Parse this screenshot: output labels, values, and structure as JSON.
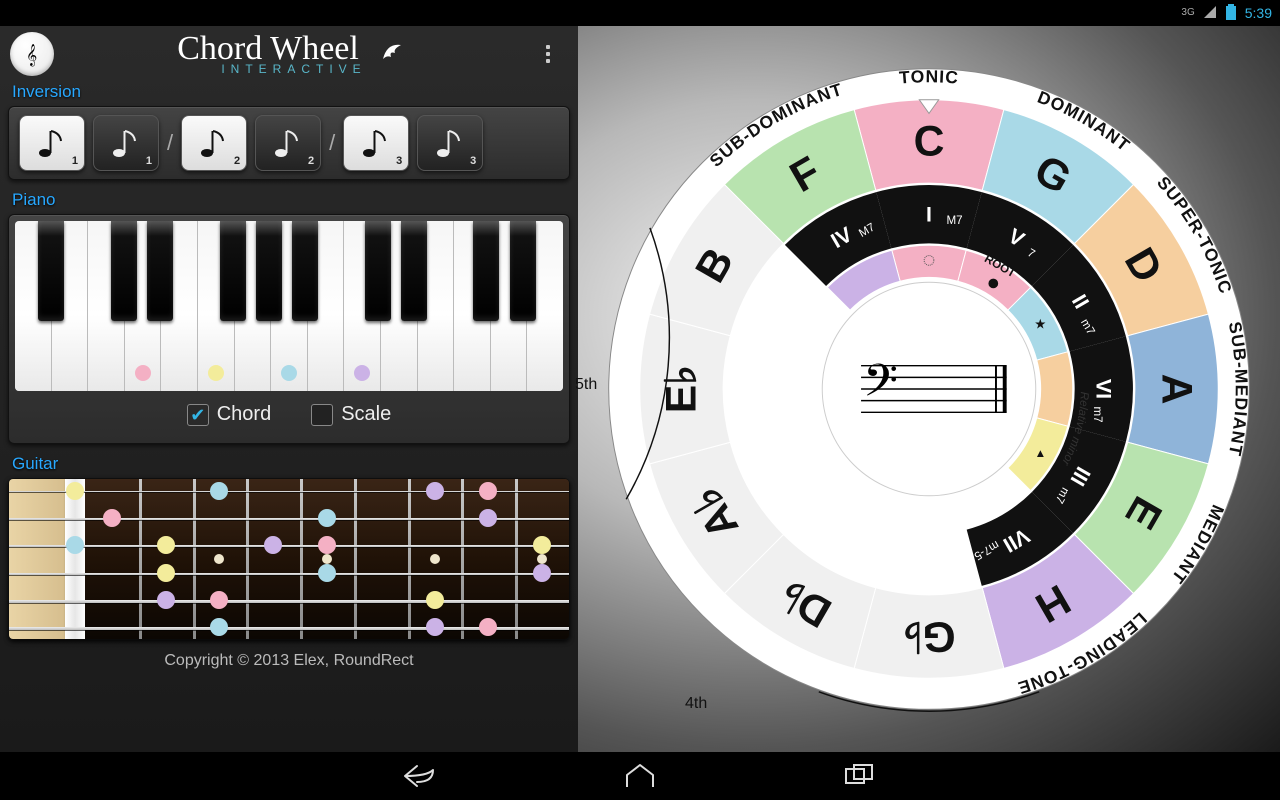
{
  "status": {
    "net_label": "3G",
    "time": "5:39"
  },
  "header": {
    "title": "Chord Wheel",
    "subtitle": "INTERACTIVE"
  },
  "sections": {
    "inversion": "Inversion",
    "piano": "Piano",
    "guitar": "Guitar"
  },
  "inversion": {
    "items": [
      {
        "sub": "1",
        "dark": false
      },
      {
        "sub": "1",
        "dark": true
      },
      {
        "sub": "2",
        "dark": false
      },
      {
        "sub": "2",
        "dark": true
      },
      {
        "sub": "3",
        "dark": false
      },
      {
        "sub": "3",
        "dark": true
      }
    ]
  },
  "piano": {
    "options": {
      "chord_label": "Chord",
      "scale_label": "Scale",
      "chord_checked": true,
      "scale_checked": false
    },
    "dots": [
      {
        "white_index": 3,
        "color": "c-pink"
      },
      {
        "white_index": 5,
        "color": "c-yellow"
      },
      {
        "white_index": 7,
        "color": "c-blue"
      },
      {
        "white_index": 9,
        "color": "c-purple"
      }
    ]
  },
  "guitar": {
    "strings": 6,
    "frets": 9,
    "markers_single": [
      3,
      5,
      7,
      9
    ],
    "dots": [
      {
        "string": 1,
        "fret": 0,
        "color": "c-yellow"
      },
      {
        "string": 1,
        "fret": 3,
        "color": "c-blue"
      },
      {
        "string": 1,
        "fret": 7,
        "color": "c-purple"
      },
      {
        "string": 1,
        "fret": 8,
        "color": "c-pink"
      },
      {
        "string": 2,
        "fret": 1,
        "color": "c-pink"
      },
      {
        "string": 2,
        "fret": 5,
        "color": "c-blue"
      },
      {
        "string": 2,
        "fret": 8,
        "color": "c-purple"
      },
      {
        "string": 3,
        "fret": 0,
        "color": "c-blue"
      },
      {
        "string": 3,
        "fret": 2,
        "color": "c-yellow"
      },
      {
        "string": 3,
        "fret": 4,
        "color": "c-purple"
      },
      {
        "string": 3,
        "fret": 5,
        "color": "c-pink"
      },
      {
        "string": 3,
        "fret": 9,
        "color": "c-yellow"
      },
      {
        "string": 4,
        "fret": 2,
        "color": "c-yellow"
      },
      {
        "string": 4,
        "fret": 5,
        "color": "c-blue"
      },
      {
        "string": 4,
        "fret": 9,
        "color": "c-purple"
      },
      {
        "string": 5,
        "fret": 2,
        "color": "c-purple"
      },
      {
        "string": 5,
        "fret": 3,
        "color": "c-pink"
      },
      {
        "string": 5,
        "fret": 7,
        "color": "c-yellow"
      },
      {
        "string": 6,
        "fret": 3,
        "color": "c-blue"
      },
      {
        "string": 6,
        "fret": 7,
        "color": "c-purple"
      },
      {
        "string": 6,
        "fret": 8,
        "color": "c-pink"
      }
    ]
  },
  "footer": {
    "copyright": "Copyright © 2013 Elex, RoundRect"
  },
  "wheel": {
    "roles": [
      "TONIC",
      "DOMINANT",
      "SUPER-TONIC",
      "SUB-MEDIANT",
      "MEDIANT",
      "LEADING-TONE",
      "",
      "",
      "",
      "",
      "",
      "SUB-DOMINANT"
    ],
    "outer_notes": [
      "C",
      "G",
      "D",
      "A",
      "E",
      "H",
      "G♭",
      "D♭",
      "A♭",
      "E♭",
      "B",
      "F"
    ],
    "outer_colors": [
      "#f4b0c4",
      "#a9d9e7",
      "#f6cf9f",
      "#8fb4d9",
      "#b8e3af",
      "#cbb2e6",
      "#f0f0f0",
      "#f0f0f0",
      "#f0f0f0",
      "#f0f0f0",
      "#f0f0f0",
      "#b8e3af"
    ],
    "inner_roman": [
      {
        "n": "I",
        "s": "M7"
      },
      {
        "n": "V",
        "s": "7"
      },
      {
        "n": "II",
        "s": "m7"
      },
      {
        "n": "VI",
        "s": "m7"
      },
      {
        "n": "III",
        "s": "m7"
      },
      {
        "n": "VII",
        "s": "m7-5"
      },
      {
        "n": "",
        "s": ""
      },
      {
        "n": "",
        "s": ""
      },
      {
        "n": "",
        "s": ""
      },
      {
        "n": "",
        "s": ""
      },
      {
        "n": "",
        "s": ""
      },
      {
        "n": "IV",
        "s": "M7"
      }
    ],
    "inner_colors": [
      "#f4b0c4",
      "#f4b0c4",
      "#a9d9e7",
      "#f6cf9f",
      "#f3ec9b",
      "",
      "",
      "",
      "",
      "",
      "",
      "#cbb2e6"
    ],
    "root_label": "ROOT",
    "relative_minor": "Relative minor",
    "fifth_hint": "5th",
    "fourth_hint": "4th"
  }
}
